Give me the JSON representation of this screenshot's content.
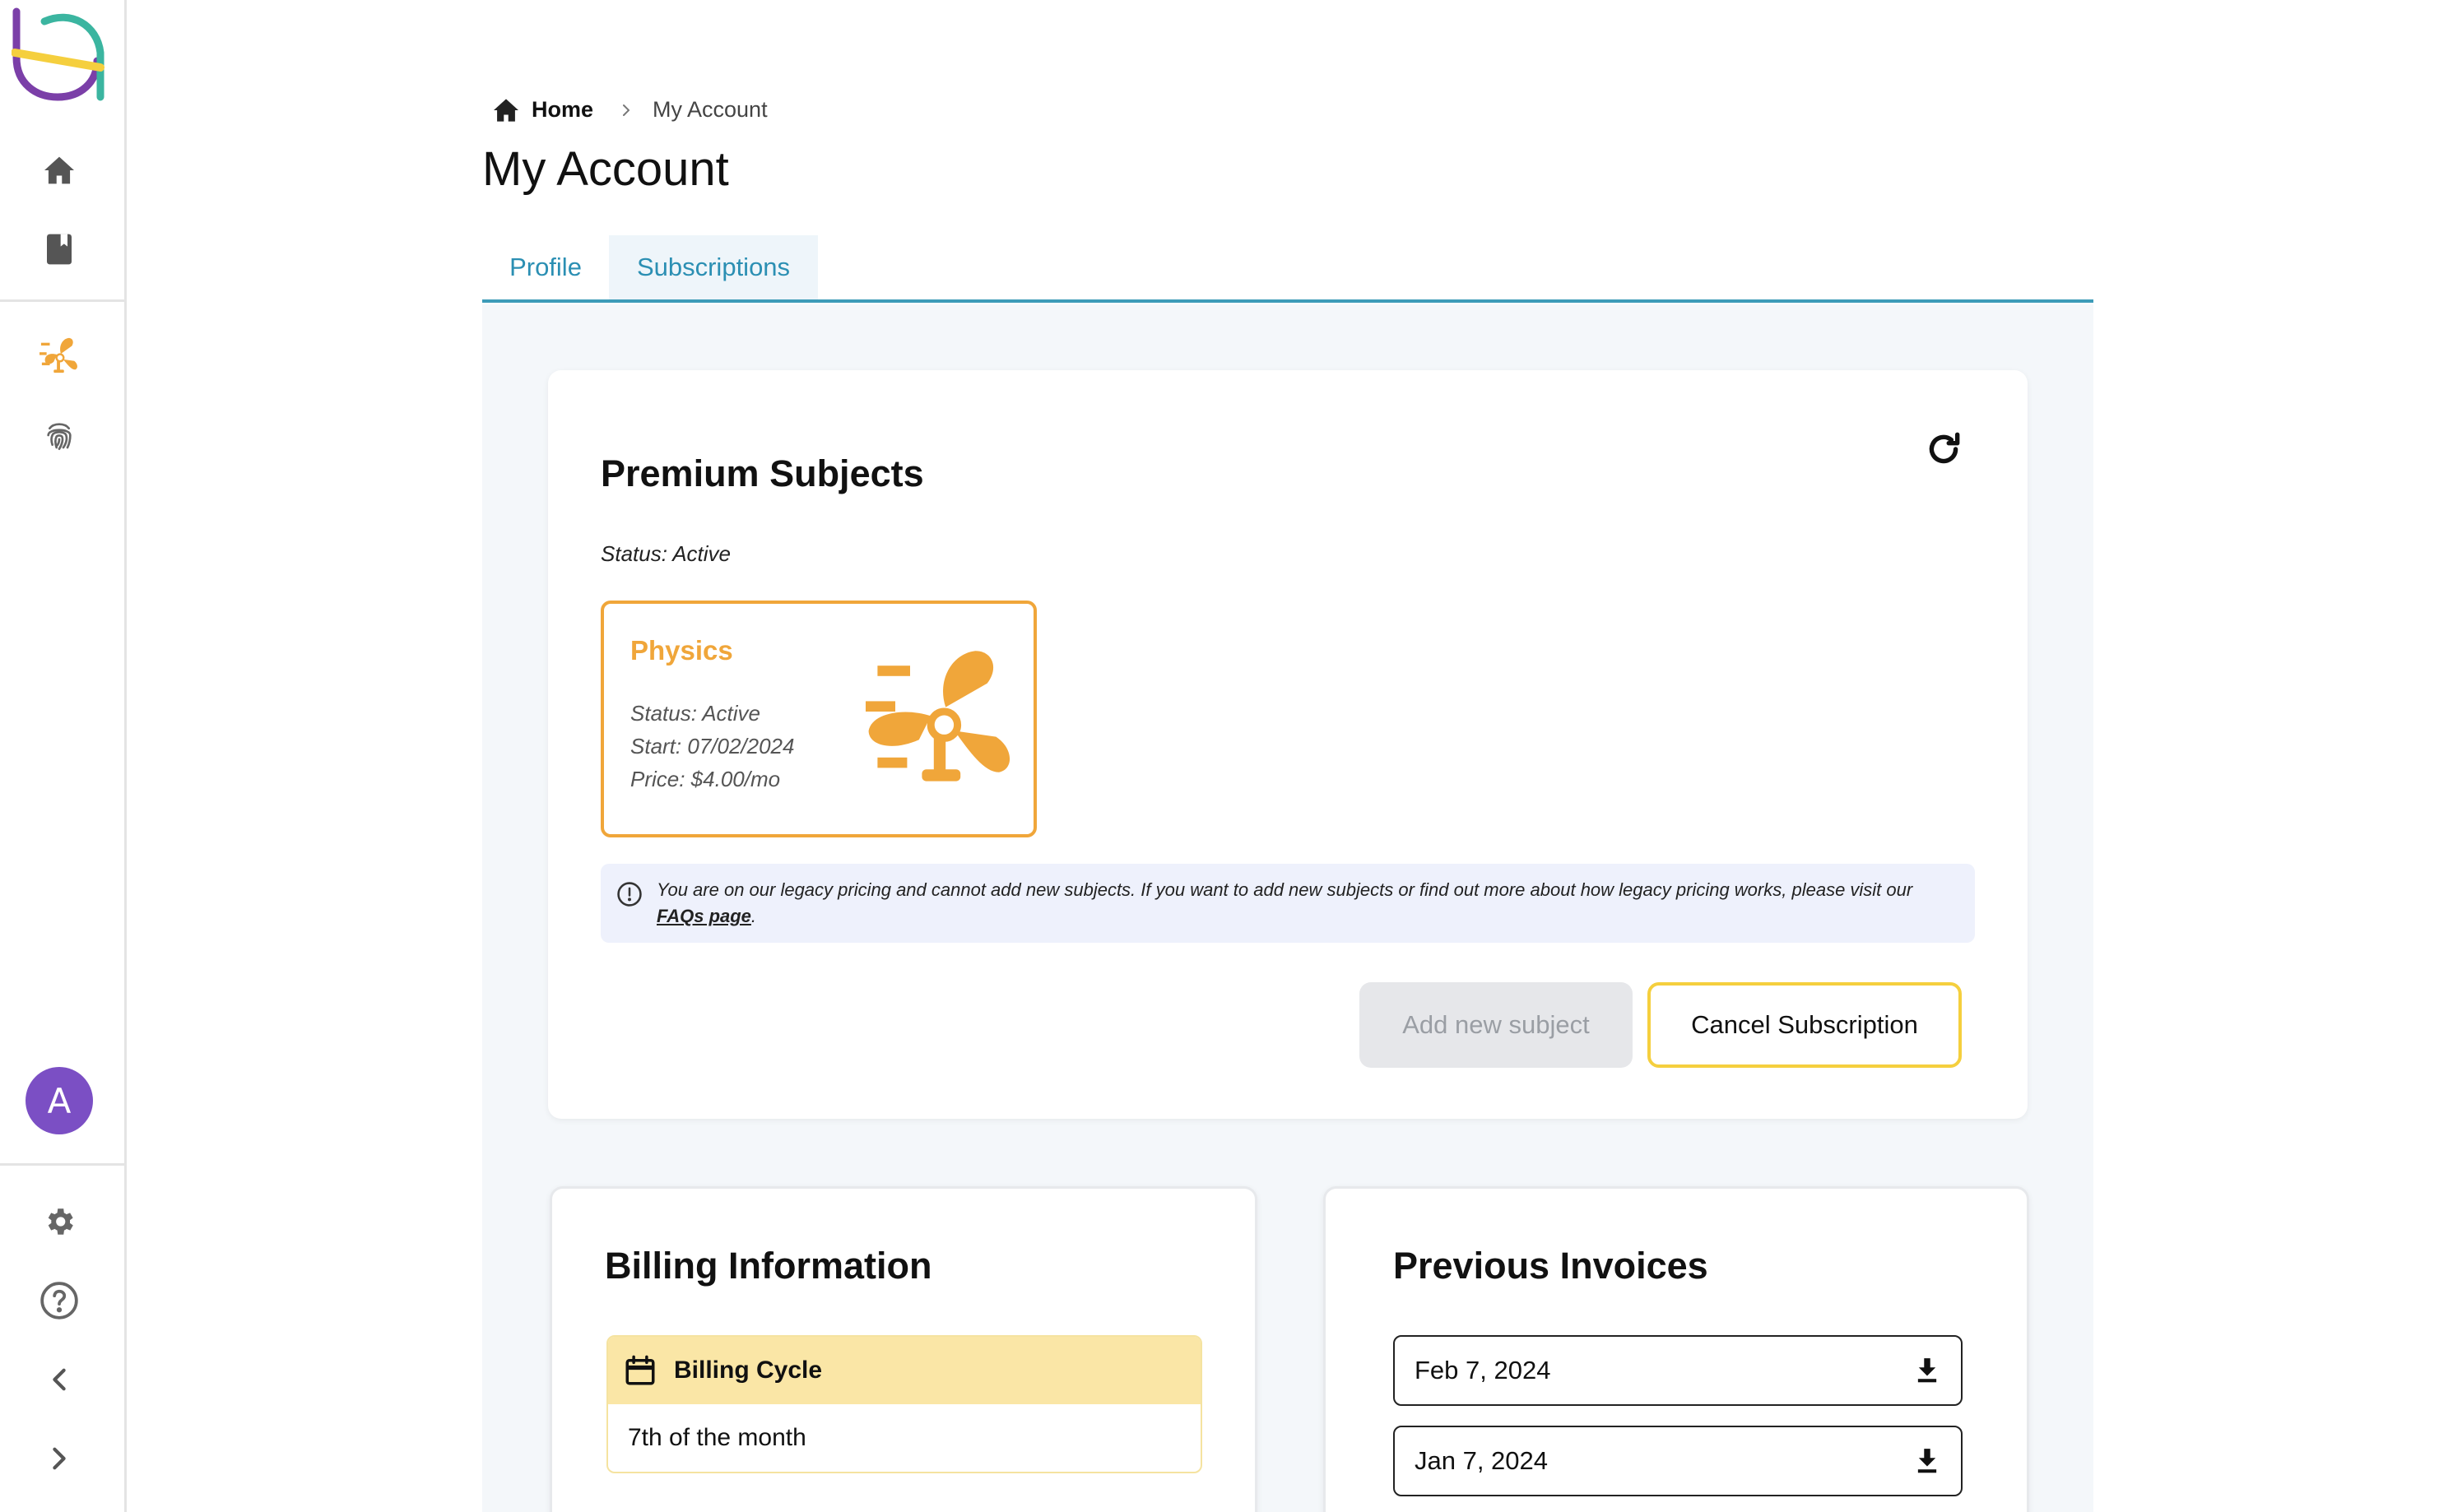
{
  "sidebar": {
    "avatar_letter": "A",
    "nav_icons": [
      "home-icon",
      "book-icon",
      "physics-fan-icon",
      "fingerprint-icon"
    ],
    "bottom_icons": [
      "gear-icon",
      "help-circle-icon",
      "chevron-left-icon",
      "chevron-right-icon"
    ]
  },
  "breadcrumb": {
    "home": "Home",
    "current": "My Account"
  },
  "page": {
    "title": "My Account"
  },
  "tabs": [
    {
      "label": "Profile",
      "active": false
    },
    {
      "label": "Subscriptions",
      "active": true
    }
  ],
  "premium": {
    "title": "Premium Subjects",
    "status": "Status: Active",
    "subject": {
      "name": "Physics",
      "status": "Status: Active",
      "start": "Start: 07/02/2024",
      "price": "Price: $4.00/mo"
    },
    "notice_text": "You are on our legacy pricing and cannot add new subjects. If you want to add new subjects or find out more about how legacy pricing works, please visit our ",
    "notice_link": "FAQs page",
    "notice_end": ".",
    "add_button": "Add new subject",
    "cancel_button": "Cancel Subscription"
  },
  "billing": {
    "title": "Billing Information",
    "cycle_label": "Billing Cycle",
    "cycle_value": "7th of the month"
  },
  "invoices": {
    "title": "Previous Invoices",
    "items": [
      "Feb 7, 2024",
      "Jan 7, 2024"
    ]
  },
  "colors": {
    "accent_teal": "#3d9bb8",
    "subject_orange": "#f0a63a",
    "cancel_yellow": "#f5cf3e",
    "avatar_purple": "#7b4fc4",
    "notice_bg": "#eef1fc"
  }
}
